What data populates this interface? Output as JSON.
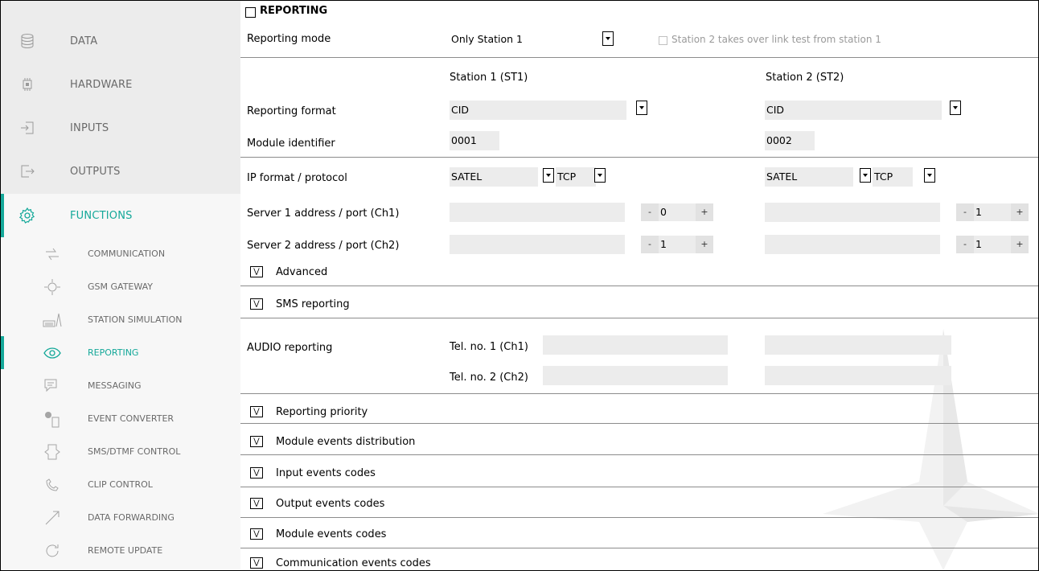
{
  "sidebar": {
    "main": [
      {
        "label": "DATA",
        "icon": "database-icon"
      },
      {
        "label": "HARDWARE",
        "icon": "chip-icon"
      },
      {
        "label": "INPUTS",
        "icon": "input-icon"
      },
      {
        "label": "OUTPUTS",
        "icon": "output-icon"
      },
      {
        "label": "FUNCTIONS",
        "icon": "gear-icon",
        "active": true
      }
    ],
    "sub": [
      {
        "label": "COMMUNICATION",
        "icon": "arrows-icon"
      },
      {
        "label": "GSM GATEWAY",
        "icon": "gsm-gateway-icon"
      },
      {
        "label": "STATION SIMULATION",
        "icon": "station-simulation-icon"
      },
      {
        "label": "REPORTING",
        "icon": "eye-icon",
        "active": true
      },
      {
        "label": "MESSAGING",
        "icon": "message-icon"
      },
      {
        "label": "EVENT CONVERTER",
        "icon": "event-converter-icon"
      },
      {
        "label": "SMS/DTMF CONTROL",
        "icon": "sms-dtmf-icon"
      },
      {
        "label": "CLIP CONTROL",
        "icon": "clip-icon"
      },
      {
        "label": "DATA FORWARDING",
        "icon": "forward-icon"
      },
      {
        "label": "REMOTE UPDATE",
        "icon": "update-icon"
      }
    ]
  },
  "reporting": {
    "title": "REPORTING",
    "mode_label": "Reporting mode",
    "mode_value": "Only Station 1",
    "takeover_label": "Station 2 takes over link test from station 1",
    "station1_header": "Station 1 (ST1)",
    "station2_header": "Station 2 (ST2)",
    "format_label": "Reporting format",
    "format_st1": "CID",
    "format_st2": "CID",
    "module_id_label": "Module identifier",
    "module_id_st1": "0001",
    "module_id_st2": "0002",
    "ip_label": "IP format / protocol",
    "ip_format_st1": "SATEL",
    "ip_proto_st1": "TCP",
    "ip_format_st2": "SATEL",
    "ip_proto_st2": "TCP",
    "server1_label": "Server 1 address / port (Ch1)",
    "server2_label": "Server 2 address / port (Ch2)",
    "server1_port_st1": "0",
    "server1_port_st2": "1",
    "server2_port_st1": "1",
    "server2_port_st2": "1",
    "minus": "-",
    "plus": "+",
    "advanced": "Advanced",
    "sms_reporting": "SMS reporting",
    "audio_label": "AUDIO reporting",
    "tel1_label": "Tel. no. 1 (Ch1)",
    "tel2_label": "Tel. no. 2 (Ch2)",
    "sections": [
      "Reporting priority",
      "Module events distribution",
      "Input events codes",
      "Output events codes",
      "Module events codes",
      "Communication events codes"
    ]
  },
  "colors": {
    "accent": "#14a899",
    "sidebar_bg": "#ececec",
    "field_bg": "#ececec"
  }
}
